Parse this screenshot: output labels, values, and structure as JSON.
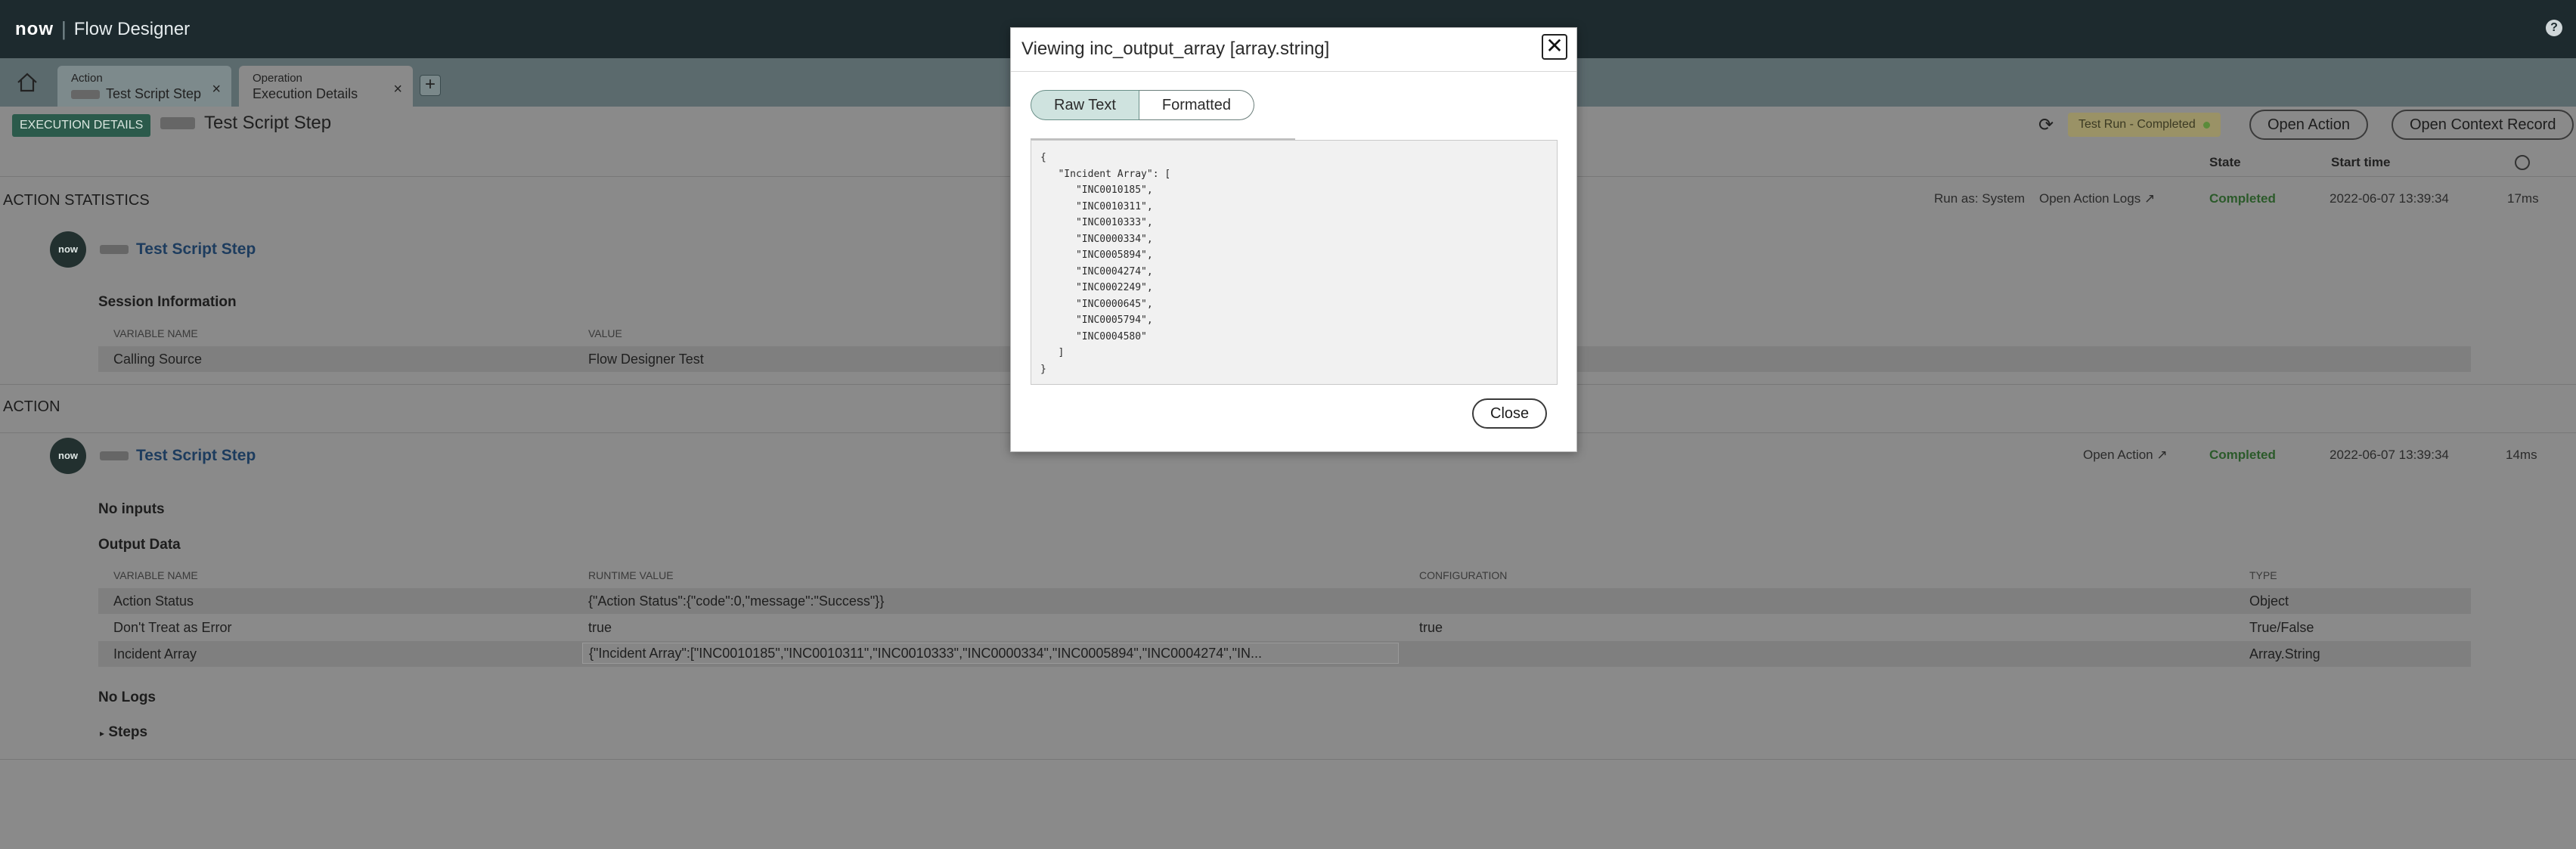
{
  "header": {
    "logo": "now",
    "app_title": "Flow Designer",
    "help": "?"
  },
  "tabs": [
    {
      "type": "Action",
      "name": "Test Script Step",
      "close": "×"
    },
    {
      "type": "Operation",
      "name": "Execution Details",
      "close": "×"
    }
  ],
  "tab_add": "+",
  "context": {
    "badge": "EXECUTION DETAILS",
    "title": "Test Script Step",
    "status": "Test Run - Completed",
    "open_action_btn": "Open Action",
    "open_context_btn": "Open Context Record",
    "col_state": "State",
    "col_start": "Start time"
  },
  "action_statistics": {
    "section_title": "ACTION STATISTICS",
    "run_as": "Run as: System",
    "logs_link": "Open Action Logs",
    "state": "Completed",
    "start_time": "2022-06-07 13:39:34",
    "duration": "17ms",
    "step_name": "Test Script Step",
    "avatar": "now",
    "session_title": "Session Information",
    "col_variable": "VARIABLE NAME",
    "col_value": "VALUE",
    "rows": [
      {
        "name": "Calling Source",
        "value": "Flow Designer Test"
      }
    ]
  },
  "action": {
    "section_title": "ACTION",
    "step_name": "Test Script Step",
    "avatar": "now",
    "open_action_link": "Open Action",
    "state": "Completed",
    "start_time": "2022-06-07 13:39:34",
    "duration": "14ms",
    "no_inputs": "No inputs",
    "output_title": "Output Data",
    "col_variable": "VARIABLE NAME",
    "col_runtime": "RUNTIME VALUE",
    "col_config": "CONFIGURATION",
    "col_type": "TYPE",
    "rows": [
      {
        "name": "Action Status",
        "runtime": "{\"Action Status\":{\"code\":0,\"message\":\"Success\"}}",
        "config": "",
        "type": "Object"
      },
      {
        "name": "Don't Treat as Error",
        "runtime": "true",
        "config": "true",
        "type": "True/False"
      },
      {
        "name": "Incident Array",
        "runtime": "{\"Incident Array\":[\"INC0010185\",\"INC0010311\",\"INC0010333\",\"INC0000334\",\"INC0005894\",\"INC0004274\",\"IN...",
        "config": "",
        "type": "Array.String"
      }
    ],
    "no_logs": "No Logs",
    "steps": "Steps"
  },
  "modal": {
    "title": "Viewing inc_output_array [array.string]",
    "close_x": "✕",
    "tab_raw": "Raw Text",
    "tab_formatted": "Formatted",
    "raw_text": "{\n   \"Incident Array\": [\n      \"INC0010185\",\n      \"INC0010311\",\n      \"INC0010333\",\n      \"INC0000334\",\n      \"INC0005894\",\n      \"INC0004274\",\n      \"INC0002249\",\n      \"INC0000645\",\n      \"INC0005794\",\n      \"INC0004580\"\n   ]\n}",
    "close_btn": "Close"
  },
  "colors": {
    "topbar": "#1d2a2e",
    "overlay": "#8a8a8a",
    "accent": "#cfe3df",
    "completed": "#2b5a2a"
  }
}
